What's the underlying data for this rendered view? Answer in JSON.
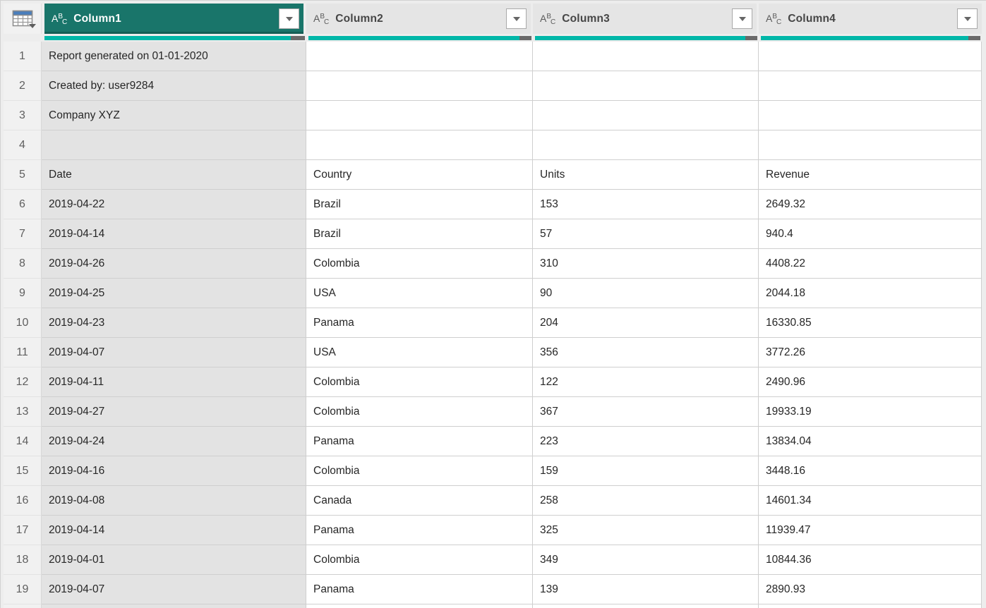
{
  "table": {
    "type_icon": {
      "a": "A",
      "b": "B",
      "c": "C"
    },
    "columns": [
      {
        "label": "Column1",
        "type": "text",
        "selected": true
      },
      {
        "label": "Column2",
        "type": "text",
        "selected": false
      },
      {
        "label": "Column3",
        "type": "text",
        "selected": false
      },
      {
        "label": "Column4",
        "type": "text",
        "selected": false
      }
    ],
    "quality": {
      "valid_fraction": 0.945,
      "empty_fraction": 0.055
    },
    "rows": [
      {
        "num": "1",
        "cells": [
          "Report generated on 01-01-2020",
          "",
          "",
          ""
        ]
      },
      {
        "num": "2",
        "cells": [
          "Created by: user9284",
          "",
          "",
          ""
        ]
      },
      {
        "num": "3",
        "cells": [
          "Company XYZ",
          "",
          "",
          ""
        ]
      },
      {
        "num": "4",
        "cells": [
          "",
          "",
          "",
          ""
        ]
      },
      {
        "num": "5",
        "cells": [
          "Date",
          "Country",
          "Units",
          "Revenue"
        ]
      },
      {
        "num": "6",
        "cells": [
          "2019-04-22",
          "Brazil",
          "153",
          "2649.32"
        ]
      },
      {
        "num": "7",
        "cells": [
          "2019-04-14",
          "Brazil",
          "57",
          "940.4"
        ]
      },
      {
        "num": "8",
        "cells": [
          "2019-04-26",
          "Colombia",
          "310",
          "4408.22"
        ]
      },
      {
        "num": "9",
        "cells": [
          "2019-04-25",
          "USA",
          "90",
          "2044.18"
        ]
      },
      {
        "num": "10",
        "cells": [
          "2019-04-23",
          "Panama",
          "204",
          "16330.85"
        ]
      },
      {
        "num": "11",
        "cells": [
          "2019-04-07",
          "USA",
          "356",
          "3772.26"
        ]
      },
      {
        "num": "12",
        "cells": [
          "2019-04-11",
          "Colombia",
          "122",
          "2490.96"
        ]
      },
      {
        "num": "13",
        "cells": [
          "2019-04-27",
          "Colombia",
          "367",
          "19933.19"
        ]
      },
      {
        "num": "14",
        "cells": [
          "2019-04-24",
          "Panama",
          "223",
          "13834.04"
        ]
      },
      {
        "num": "15",
        "cells": [
          "2019-04-16",
          "Colombia",
          "159",
          "3448.16"
        ]
      },
      {
        "num": "16",
        "cells": [
          "2019-04-08",
          "Canada",
          "258",
          "14601.34"
        ]
      },
      {
        "num": "17",
        "cells": [
          "2019-04-14",
          "Panama",
          "325",
          "11939.47"
        ]
      },
      {
        "num": "18",
        "cells": [
          "2019-04-01",
          "Colombia",
          "349",
          "10844.36"
        ]
      },
      {
        "num": "19",
        "cells": [
          "2019-04-07",
          "Panama",
          "139",
          "2890.93"
        ]
      }
    ]
  },
  "colors": {
    "accent_dark_teal": "#19756A",
    "quality_valid": "#00B7A8",
    "quality_empty": "#6A6A6A",
    "header_bg": "#E5E5E5",
    "selected_cell_bg": "#E3E3E3",
    "corner_icon_blue": "#4A7EBC"
  }
}
